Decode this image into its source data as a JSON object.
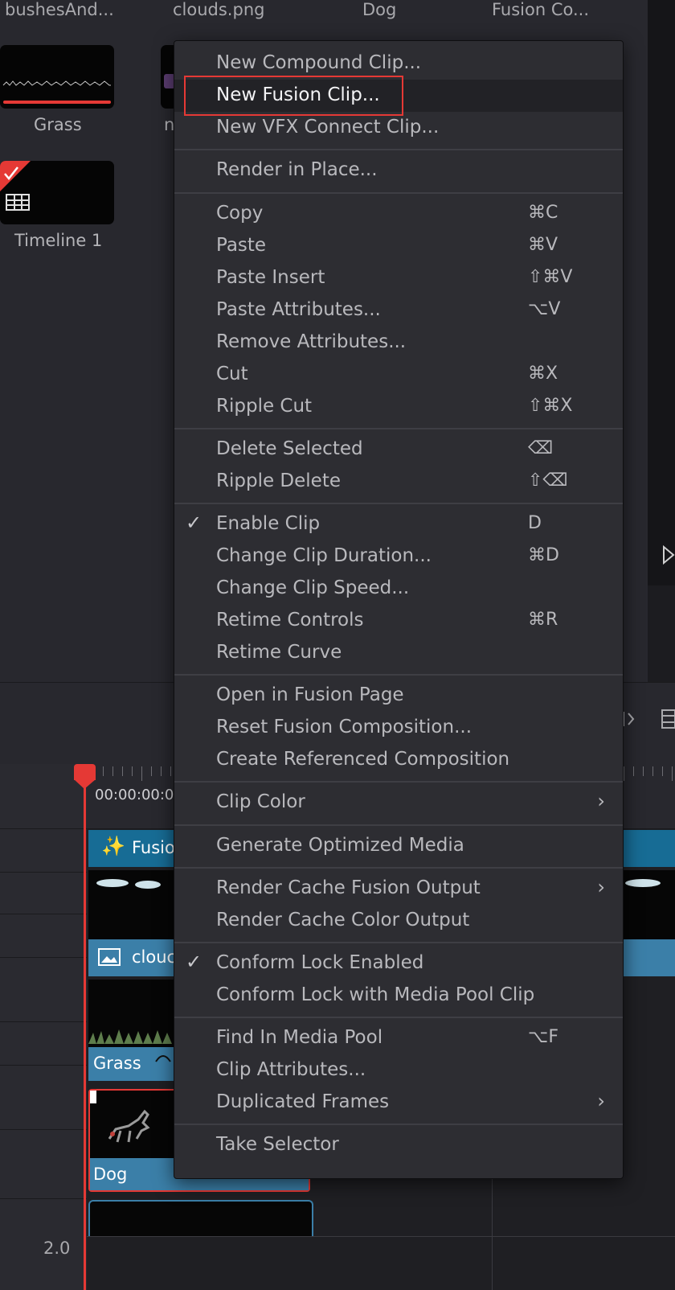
{
  "media_pool": {
    "column_labels": [
      "bushesAnd...",
      "clouds.png",
      "Dog",
      "Fusion Co..."
    ],
    "items": [
      {
        "label": "Grass"
      },
      {
        "label": "n"
      },
      {
        "label": "Timeline 1"
      }
    ]
  },
  "timeline": {
    "timecode": "00:00:00:0",
    "scale_value": "2.0",
    "clips": {
      "fusion": "Fusio",
      "clouds": "clouc",
      "grass": "Grass",
      "dog": "Dog"
    }
  },
  "context_menu": {
    "items": [
      {
        "label": "New Compound Clip...",
        "shortcut": ""
      },
      {
        "label": "New Fusion Clip...",
        "shortcut": "",
        "highlighted": true
      },
      {
        "label": "New VFX Connect Clip...",
        "shortcut": ""
      },
      {
        "label": "Render in Place...",
        "shortcut": ""
      },
      {
        "label": "Copy",
        "shortcut": "⌘C"
      },
      {
        "label": "Paste",
        "shortcut": "⌘V"
      },
      {
        "label": "Paste Insert",
        "shortcut": "⇧⌘V"
      },
      {
        "label": "Paste Attributes...",
        "shortcut": "⌥V"
      },
      {
        "label": "Remove Attributes...",
        "shortcut": ""
      },
      {
        "label": "Cut",
        "shortcut": "⌘X"
      },
      {
        "label": "Ripple Cut",
        "shortcut": "⇧⌘X"
      },
      {
        "label": "Delete Selected",
        "shortcut": "⌫"
      },
      {
        "label": "Ripple Delete",
        "shortcut": "⇧⌫"
      },
      {
        "label": "Enable Clip",
        "shortcut": "D",
        "checked": true
      },
      {
        "label": "Change Clip Duration...",
        "shortcut": "⌘D"
      },
      {
        "label": "Change Clip Speed...",
        "shortcut": ""
      },
      {
        "label": "Retime Controls",
        "shortcut": "⌘R"
      },
      {
        "label": "Retime Curve",
        "shortcut": ""
      },
      {
        "label": "Open in Fusion Page",
        "shortcut": ""
      },
      {
        "label": "Reset Fusion Composition...",
        "shortcut": ""
      },
      {
        "label": "Create Referenced Composition",
        "shortcut": ""
      },
      {
        "label": "Clip Color",
        "shortcut": "",
        "submenu": true
      },
      {
        "label": "Generate Optimized Media",
        "shortcut": ""
      },
      {
        "label": "Render Cache Fusion Output",
        "shortcut": "",
        "submenu": true
      },
      {
        "label": "Render Cache Color Output",
        "shortcut": ""
      },
      {
        "label": "Conform Lock Enabled",
        "shortcut": "",
        "checked": true
      },
      {
        "label": "Conform Lock with Media Pool Clip",
        "shortcut": ""
      },
      {
        "label": "Find In Media Pool",
        "shortcut": "⌥F"
      },
      {
        "label": "Clip Attributes...",
        "shortcut": ""
      },
      {
        "label": "Duplicated Frames",
        "shortcut": "",
        "submenu": true
      },
      {
        "label": "Take Selector",
        "shortcut": ""
      }
    ]
  },
  "colors": {
    "accent_red": "#e53935",
    "clip_blue": "#176c95",
    "menu_bg": "#2d2d32"
  }
}
